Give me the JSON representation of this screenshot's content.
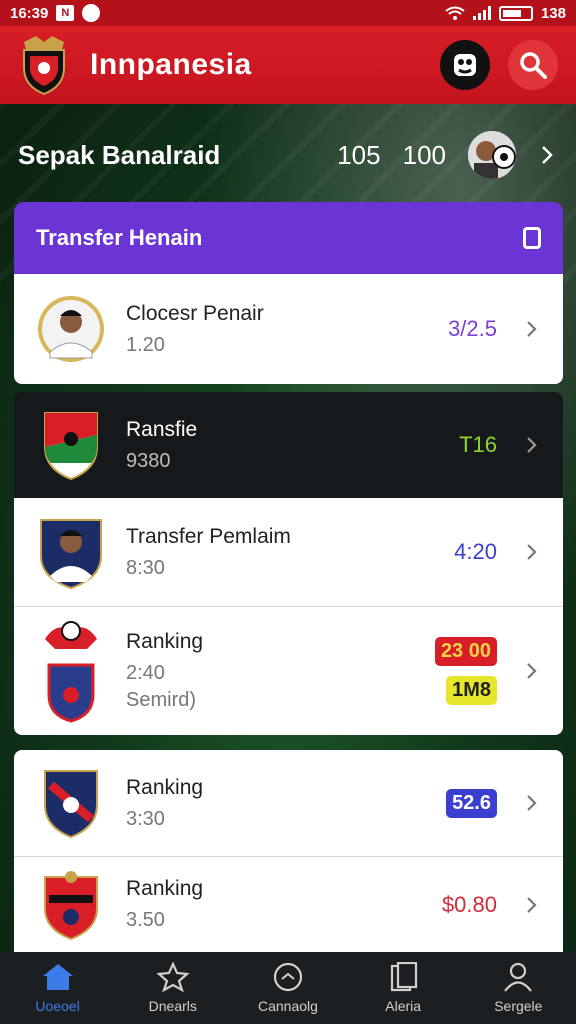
{
  "status_bar": {
    "time": "16:39",
    "battery": "138"
  },
  "app_bar": {
    "title": "Innpanesia"
  },
  "score": {
    "title": "Sepak Banalraid",
    "value_a": "105",
    "value_b": "100"
  },
  "section": {
    "title": "Transfer Henain"
  },
  "cards": [
    {
      "name": "Clocesr Penair",
      "sub": "1.20",
      "value": "3/2.5",
      "value_color": "#7b3fd6"
    },
    {
      "name": "Ransfie",
      "sub": "9380",
      "value": "T16",
      "value_color": "#8ed62a"
    },
    {
      "name": "Transfer Pemlaim",
      "sub": "8:30",
      "value": "4:20",
      "value_color": "#3b3fcf"
    },
    {
      "name": "Ranking",
      "sub": "2:40",
      "sub2": "Semird)",
      "badge1": "23 00",
      "badge2": "1M8"
    },
    {
      "name": "Ranking",
      "sub": "3:30",
      "badge1": "52.6"
    },
    {
      "name": "Ranking",
      "sub": "3.50",
      "value": "$0.80",
      "value_color": "#d62a3a"
    }
  ],
  "nav": [
    {
      "label": "Uoeoel",
      "icon": "home-icon"
    },
    {
      "label": "Dnearls",
      "icon": "star-icon"
    },
    {
      "label": "Cannaolg",
      "icon": "ball-icon"
    },
    {
      "label": "Aleria",
      "icon": "cards-icon"
    },
    {
      "label": "Sergele",
      "icon": "profile-icon"
    }
  ],
  "colors": {
    "primary": "#d81e27",
    "accent": "#6b35d6",
    "nav_active": "#3d7be8"
  }
}
